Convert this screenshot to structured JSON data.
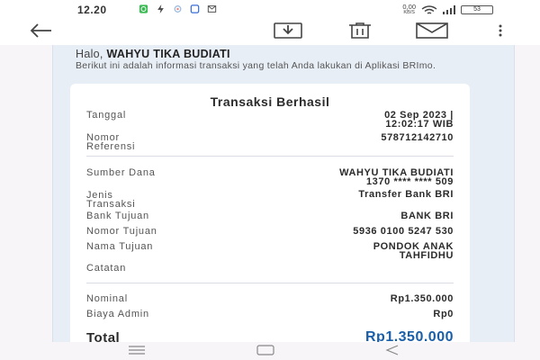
{
  "status_bar": {
    "time": "12.20",
    "network_speed": "0,00",
    "network_unit": "KB/S",
    "battery": "53"
  },
  "header": {
    "greeting_prefix": "Halo, ",
    "user_name": "WAHYU TIKA BUDIATI",
    "intro_text": "Berikut ini adalah informasi transaksi yang telah Anda lakukan di Aplikasi BRImo."
  },
  "receipt": {
    "title": "Transaksi Berhasil",
    "rows": [
      {
        "label": "Tanggal",
        "value": "02 Sep 2023 |\n12:02:17 WIB"
      },
      {
        "label": "Nomor\nReferensi",
        "value": "578712142710"
      },
      {
        "label": "Sumber Dana",
        "value": "WAHYU TIKA BUDIATI\n1370 **** **** 509"
      },
      {
        "label": "Jenis\nTransaksi",
        "value": "Transfer Bank BRI"
      },
      {
        "label": "Bank Tujuan",
        "value": "BANK BRI"
      },
      {
        "label": "Nomor Tujuan",
        "value": "5936 0100 5247 530"
      },
      {
        "label": "Nama Tujuan",
        "value": "PONDOK ANAK\nTAHFIDHU"
      },
      {
        "label": "Catatan",
        "value": ""
      },
      {
        "label": "Nominal",
        "value": "Rp1.350.000"
      },
      {
        "label": "Biaya Admin",
        "value": "Rp0"
      }
    ],
    "total_label": "Total",
    "total_value": "Rp1.350.000"
  },
  "colors": {
    "accent": "#1a5ea8",
    "frame_bg": "#e8eef6"
  },
  "icons": {
    "back": "arrow-left-icon",
    "download": "download-icon",
    "delete": "trash-icon",
    "mail": "mail-icon",
    "more": "more-vertical-icon"
  }
}
